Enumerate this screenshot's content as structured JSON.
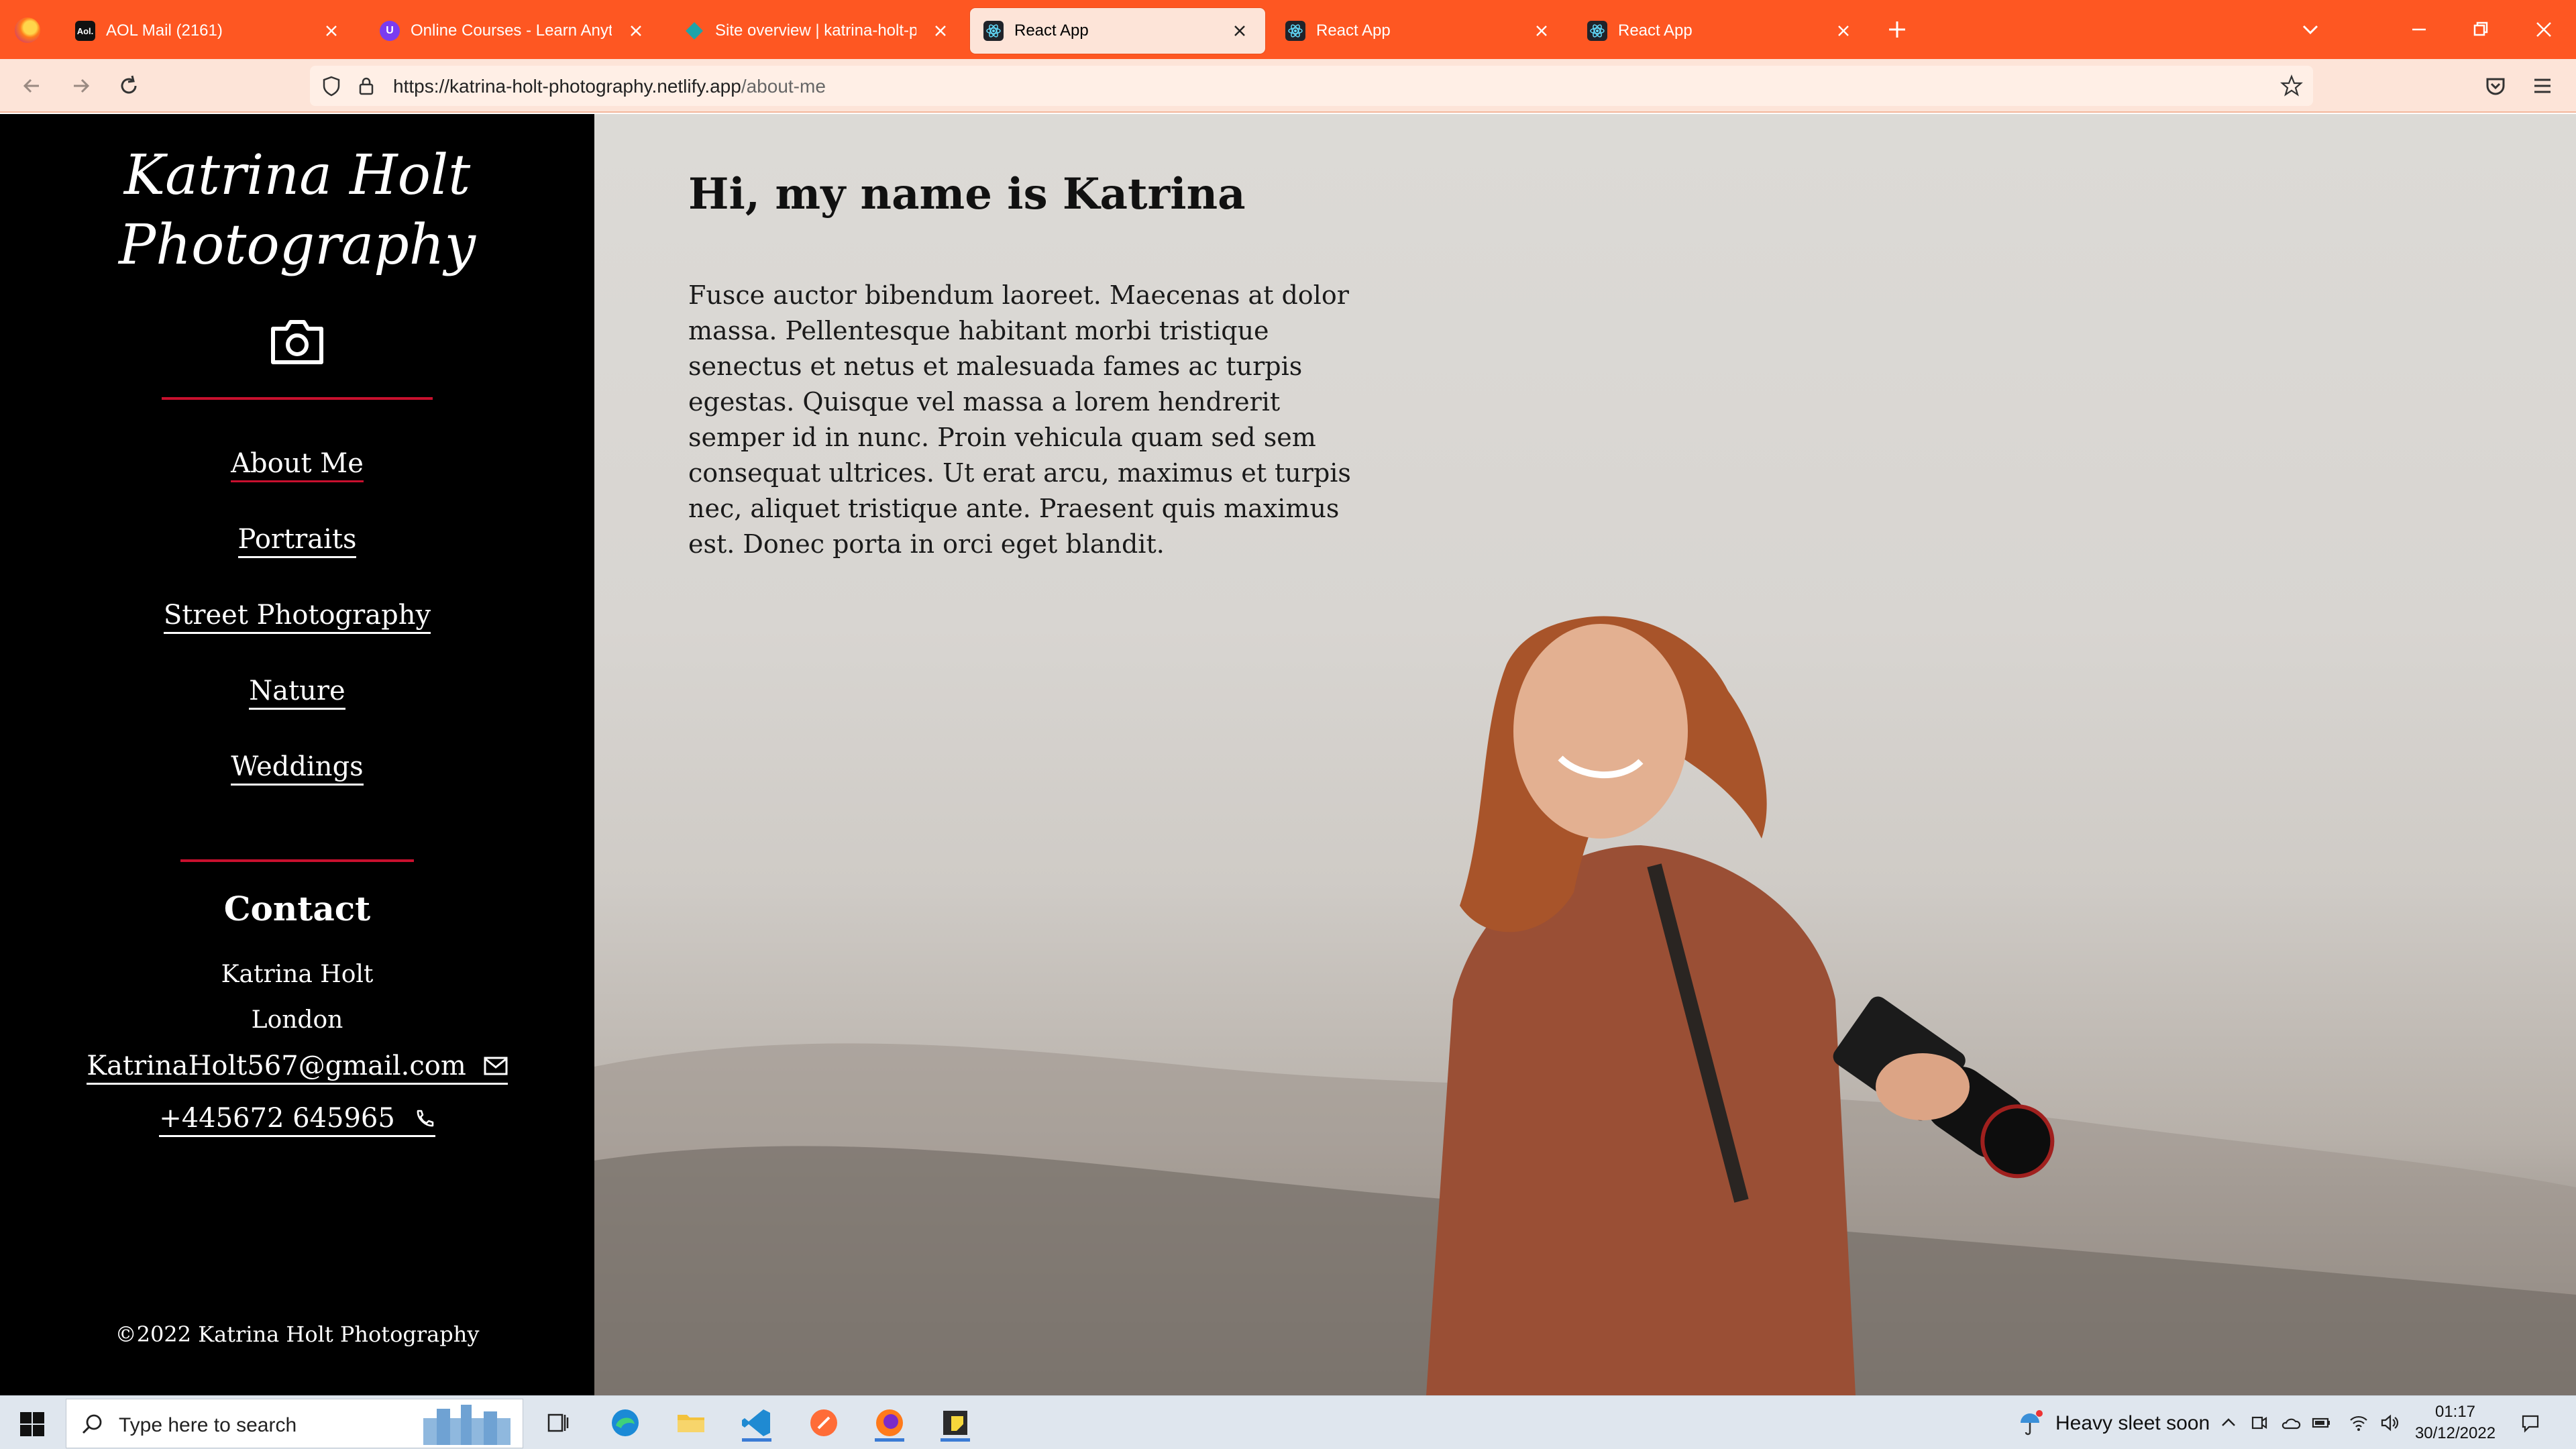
{
  "browser": {
    "tabs": [
      {
        "title": "AOL Mail (2161)",
        "active": false
      },
      {
        "title": "Online Courses - Learn Anything",
        "active": false
      },
      {
        "title": "Site overview | katrina-holt-pho",
        "active": false
      },
      {
        "title": "React App",
        "active": true
      },
      {
        "title": "React App",
        "active": false
      },
      {
        "title": "React App",
        "active": false
      }
    ],
    "url_host": "https://katrina-holt-photography.netlify.app",
    "url_path": "/about-me"
  },
  "site": {
    "brand_line1": "Katrina Holt",
    "brand_line2": "Photography",
    "nav": [
      {
        "label": "About Me",
        "current": true
      },
      {
        "label": "Portraits",
        "current": false
      },
      {
        "label": "Street Photography",
        "current": false
      },
      {
        "label": "Nature",
        "current": false
      },
      {
        "label": "Weddings",
        "current": false
      }
    ],
    "contact": {
      "title": "Contact",
      "name": "Katrina Holt",
      "city": "London",
      "email": "KatrinaHolt567@gmail.com",
      "phone": "+445672 645965"
    },
    "footer": "©2022 Katrina Holt Photography"
  },
  "hero": {
    "title": "Hi, my name is Katrina",
    "body": "Fusce auctor bibendum laoreet. Maecenas at dolor massa. Pellentesque habitant morbi tristique senectus et netus et malesuada fames ac turpis egestas. Quisque vel massa a lorem hendrerit semper id in nunc. Proin vehicula quam sed sem consequat ultrices. Ut erat arcu, maximus et turpis nec, aliquet tristique ante. Praesent quis maximus est. Donec porta in orci eget blandit."
  },
  "taskbar": {
    "search_placeholder": "Type here to search",
    "weather": "Heavy sleet soon",
    "time": "01:17",
    "date": "30/12/2022"
  },
  "colors": {
    "browser_accent": "#fe5722",
    "nav_bg": "#fde4d8",
    "sidebar_bg": "#000000",
    "accent_red": "#c8102e"
  }
}
